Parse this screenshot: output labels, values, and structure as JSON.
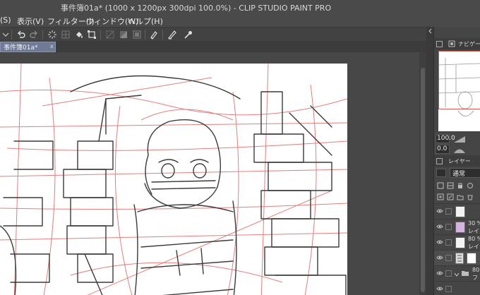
{
  "window": {
    "title": "事件簿01a* (1000 x 1200px 300dpi 100.0%) - CLIP STUDIO PAINT PRO"
  },
  "menubar": {
    "items": [
      "(S)",
      "表示(V)",
      "フィルター(I)",
      "ウィンドウ(W)",
      "ヘルプ(H)"
    ]
  },
  "document_tab": {
    "label": "事件簿01a*",
    "close": "x"
  },
  "navigator": {
    "title": "ナビゲーター",
    "zoom": "100.0",
    "angle": "0.0"
  },
  "layers": {
    "title": "レイヤー",
    "blend_mode": "通常",
    "rows": [
      {
        "opacity": "",
        "name": "",
        "thumb_color": "#f2f2f2"
      },
      {
        "opacity": "30 %",
        "name": "レイ",
        "thumb_color": "#d8b2e0"
      },
      {
        "opacity": "80 %",
        "name": "レイ",
        "thumb_color": "#f2f2f2"
      },
      {
        "opacity": "",
        "name": "",
        "thumb_color": "#ffffff"
      },
      {
        "opacity": "80",
        "name": "フ",
        "thumb_color": "#bdbdbd"
      }
    ]
  },
  "colors": {
    "sketch_red": "#d9534f",
    "line_dark": "#3a3a3a",
    "tab_blue": "#6f7a96"
  }
}
